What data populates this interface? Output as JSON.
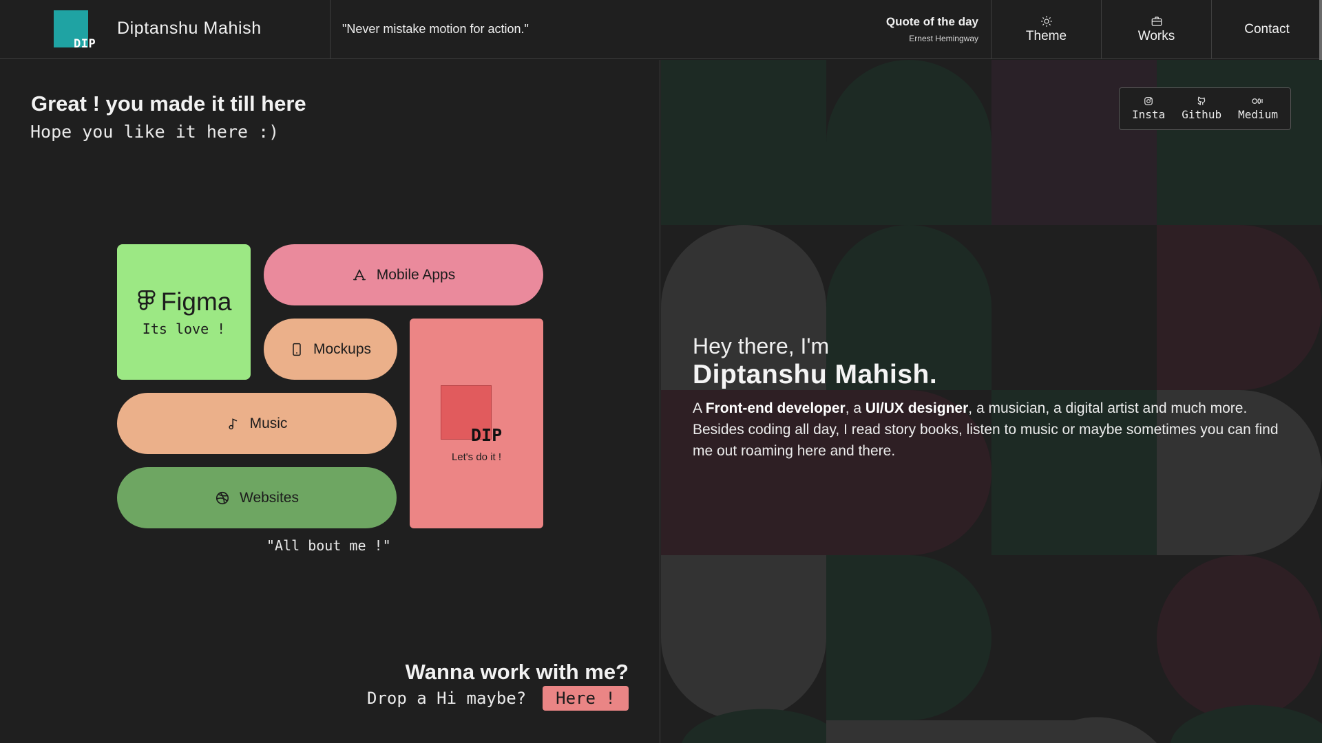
{
  "header": {
    "logo_text": "DIP",
    "site_name": "Diptanshu Mahish",
    "quote": "\"Never mistake motion for action.\"",
    "quote_of_day_label": "Quote of the day",
    "quote_author": "Ernest Hemingway",
    "nav": {
      "theme": "Theme",
      "works": "Works",
      "contact": "Contact"
    }
  },
  "left": {
    "greeting_title": "Great ! you made it till here",
    "greeting_sub": "Hope you like it here :)",
    "tiles": {
      "figma_name": "Figma",
      "figma_sub": "Its love !",
      "mobile_apps": "Mobile Apps",
      "mockups": "Mockups",
      "music": "Music",
      "websites": "Websites",
      "dip_word": "DIP",
      "dip_cta": "Let's do it !"
    },
    "about_quote": "\"All bout me !\"",
    "work_title": "Wanna work with me?",
    "work_sub": "Drop a Hi maybe?",
    "here_button": "Here !"
  },
  "right": {
    "socials": {
      "insta": "Insta",
      "github": "Github",
      "medium": "Medium"
    },
    "hello": "Hey there, I'm",
    "name": "Diptanshu Mahish.",
    "bio": {
      "p1": "A ",
      "b1": "Front-end developer",
      "p2": ", a ",
      "b2": "UI/UX designer",
      "p3": ", a musician, a digital artist and much more. Besides coding all day, I read story books, listen to music or maybe sometimes you can find me out roaming here and there."
    }
  },
  "colors": {
    "background": "#1f1f1f",
    "logo_teal": "#1fa3a3",
    "figma_green": "#9ce884",
    "mobile_pink": "#ea8a9c",
    "peach": "#ebb08a",
    "websites_green": "#6ea662",
    "dip_red": "#ec8585"
  },
  "icons": {
    "theme": "sun-icon",
    "works": "briefcase-icon",
    "figma": "figma-icon",
    "mobile_apps": "app-store-icon",
    "mockups": "smartphone-icon",
    "music": "music-note-icon",
    "websites": "dribbble-icon",
    "insta": "instagram-icon",
    "github": "github-icon",
    "medium": "medium-icon"
  }
}
